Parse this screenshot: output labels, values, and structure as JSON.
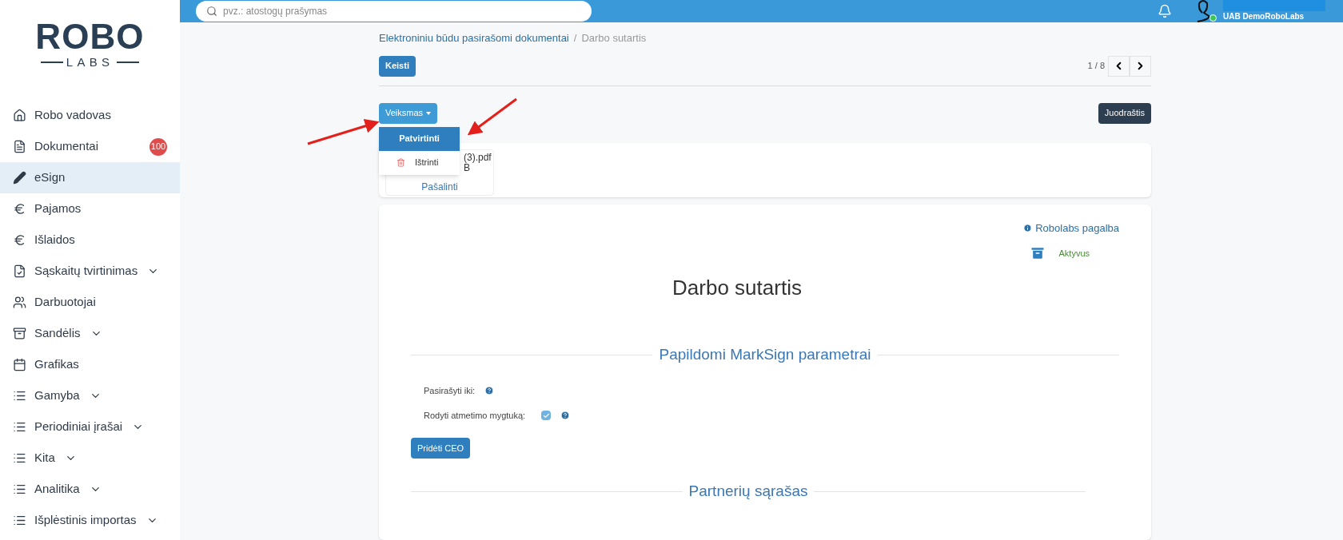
{
  "logo": {
    "top": "ROBO",
    "bottom": "LABS"
  },
  "sidebar": {
    "items": [
      {
        "label": "Robo vadovas",
        "selected": false
      },
      {
        "label": "Dokumentai",
        "selected": false,
        "badge": "100"
      },
      {
        "label": "eSign",
        "selected": true
      },
      {
        "label": "Pajamos",
        "selected": false
      },
      {
        "label": "Išlaidos",
        "selected": false
      },
      {
        "label": "Sąskaitų tvirtinimas",
        "selected": false,
        "expanded": false
      },
      {
        "label": "Darbuotojai",
        "selected": false
      },
      {
        "label": "Sandėlis",
        "selected": false,
        "expanded": false
      },
      {
        "label": "Grafikas",
        "selected": false
      },
      {
        "label": "Gamyba",
        "selected": false,
        "expanded": false
      },
      {
        "label": "Periodiniai įrašai",
        "selected": false,
        "expanded": false
      },
      {
        "label": "Kita",
        "selected": false,
        "expanded": false
      },
      {
        "label": "Analitika",
        "selected": false,
        "expanded": false
      },
      {
        "label": "Išplėstinis importas",
        "selected": false,
        "expanded": false
      }
    ]
  },
  "topbar": {
    "search": {
      "placeholder": "pvz.: atostogų prašymas"
    },
    "user": {
      "name": "UAB DemoRoboLabs",
      "online": true
    }
  },
  "breadcrumb_separator": "/",
  "breadcrumb": [
    {
      "label": "Elektroniniu būdu pasirašomi dokumentai",
      "current": false
    },
    {
      "label": "Darbo sutartis",
      "current": true
    }
  ],
  "edit_button": "Keisti",
  "pager": {
    "text": "1 / 8"
  },
  "action_button": "Veiksmas",
  "action_menu": [
    {
      "label": "Patvirtinti",
      "kind": "plain",
      "selected": true
    },
    {
      "label": "Ištrinti",
      "kind": "delete",
      "selected": false
    }
  ],
  "status_button": "Juodraštis",
  "attachment": {
    "name_visible": "(3).pdf",
    "size_visible": "B",
    "remove": "Pašalinti"
  },
  "document": {
    "help_link": "Robolabs pagalba",
    "status": "Aktyvus",
    "title": "Darbo sutartis",
    "section_1": "Papildomi MarkSign parametrai",
    "fields": [
      {
        "label": "Pasirašyti iki:",
        "kind": "help"
      },
      {
        "label": "Rodyti atmetimo mygtuką:",
        "kind": "checkbox",
        "checked": true
      }
    ],
    "add_ceo": "Pridėti CEO",
    "section_2": "Partnerių sąrašas"
  }
}
